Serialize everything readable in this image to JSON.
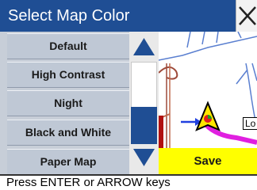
{
  "title": "Select Map Color",
  "menu": {
    "items": [
      {
        "label": "Default"
      },
      {
        "label": "High Contrast"
      },
      {
        "label": "Night"
      },
      {
        "label": "Black and White"
      },
      {
        "label": "Paper Map"
      }
    ]
  },
  "map": {
    "road_label": "Lo"
  },
  "save_label": "Save",
  "status_text": "Press ENTER or ARROW keys",
  "icons": {
    "close": "close-icon",
    "scroll_up": "triangle-up-icon",
    "scroll_down": "triangle-down-icon",
    "vehicle": "vehicle-arrow-icon",
    "destination": "arrow-icon"
  },
  "colors": {
    "title_bar": "#1f4e94",
    "menu_item": "#bfc8d5",
    "scroll_thumb": "#1f4e94",
    "save_button": "#ffff00",
    "route": "#e020e0"
  }
}
